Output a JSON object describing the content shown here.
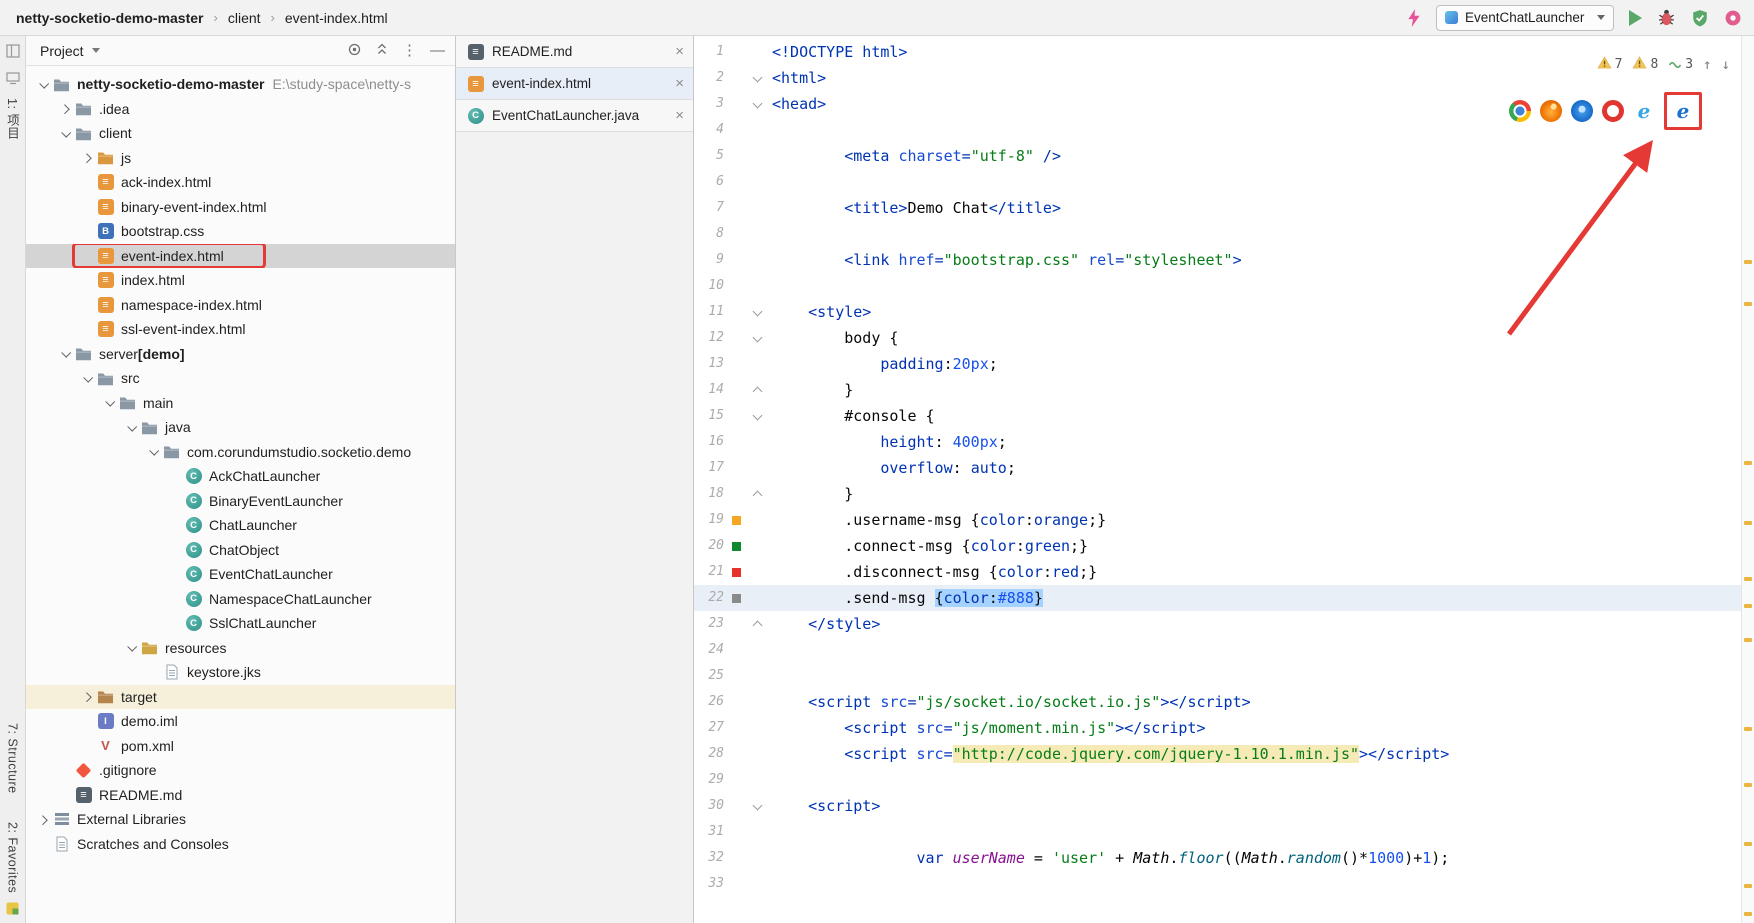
{
  "window": {
    "breadcrumbs": [
      "netty-socketio-demo-master",
      "client",
      "event-index.html"
    ]
  },
  "run": {
    "config": "EventChatLauncher"
  },
  "toolstrip": {
    "top_tab": "1: 项目",
    "structure_tab": "7: Structure",
    "favorites_tab": "2: Favorites"
  },
  "project": {
    "title": "Project",
    "tree": [
      {
        "level": 0,
        "chevron": "open",
        "icon": "folder-project",
        "label": "netty-socketio-demo-master",
        "bold": true,
        "path": "E:\\study-space\\netty-s"
      },
      {
        "level": 1,
        "chevron": "closed",
        "icon": "folder-idea",
        "label": ".idea"
      },
      {
        "level": 1,
        "chevron": "open",
        "icon": "folder",
        "label": "client"
      },
      {
        "level": 2,
        "chevron": "closed",
        "icon": "folder-js",
        "label": "js"
      },
      {
        "level": 2,
        "icon": "html",
        "label": "ack-index.html"
      },
      {
        "level": 2,
        "icon": "html",
        "label": "binary-event-index.html"
      },
      {
        "level": 2,
        "icon": "css",
        "label": "bootstrap.css"
      },
      {
        "level": 2,
        "icon": "html",
        "label": "event-index.html",
        "selected": true,
        "redbox": true
      },
      {
        "level": 2,
        "icon": "html",
        "label": "index.html"
      },
      {
        "level": 2,
        "icon": "html",
        "label": "namespace-index.html"
      },
      {
        "level": 2,
        "icon": "html",
        "label": "ssl-event-index.html"
      },
      {
        "level": 1,
        "chevron": "open",
        "icon": "folder",
        "label": "server",
        "suffix": " [demo]"
      },
      {
        "level": 2,
        "chevron": "open",
        "icon": "folder",
        "label": "src"
      },
      {
        "level": 3,
        "chevron": "open",
        "icon": "folder",
        "label": "main"
      },
      {
        "level": 4,
        "chevron": "open",
        "icon": "folder-java",
        "label": "java"
      },
      {
        "level": 5,
        "chevron": "open",
        "icon": "folder",
        "label": "com.corundumstudio.socketio.demo"
      },
      {
        "level": 6,
        "icon": "class",
        "label": "AckChatLauncher"
      },
      {
        "level": 6,
        "icon": "class",
        "label": "BinaryEventLauncher"
      },
      {
        "level": 6,
        "icon": "class",
        "label": "ChatLauncher"
      },
      {
        "level": 6,
        "icon": "class",
        "label": "ChatObject"
      },
      {
        "level": 6,
        "icon": "class",
        "label": "EventChatLauncher"
      },
      {
        "level": 6,
        "icon": "class",
        "label": "NamespaceChatLauncher"
      },
      {
        "level": 6,
        "icon": "class",
        "label": "SslChatLauncher"
      },
      {
        "level": 4,
        "chevron": "open",
        "icon": "folder-resources",
        "label": "resources"
      },
      {
        "level": 5,
        "icon": "file",
        "label": "keystore.jks"
      },
      {
        "level": 2,
        "chevron": "closed",
        "icon": "folder-target",
        "label": "target",
        "rowbg": "#F6EFDA"
      },
      {
        "level": 2,
        "icon": "iml",
        "label": "demo.iml"
      },
      {
        "level": 2,
        "icon": "maven",
        "label": "pom.xml"
      },
      {
        "level": 1,
        "icon": "git",
        "label": ".gitignore"
      },
      {
        "level": 1,
        "icon": "md",
        "label": "README.md"
      },
      {
        "level": 0,
        "chevron": "closed",
        "icon": "library",
        "label": "External Libraries"
      },
      {
        "level": 0,
        "icon": "scratches",
        "label": "Scratches and Consoles"
      }
    ]
  },
  "editor_tabs": [
    {
      "icon": "md",
      "label": "README.md"
    },
    {
      "icon": "html",
      "label": "event-index.html",
      "active": true
    },
    {
      "icon": "class",
      "label": "EventChatLauncher.java"
    }
  ],
  "editor": {
    "inspections": {
      "warnings": "7",
      "weak_warnings": "8",
      "typos": "3"
    },
    "browsers": [
      {
        "name": "chrome"
      },
      {
        "name": "firefox"
      },
      {
        "name": "safari"
      },
      {
        "name": "opera"
      },
      {
        "name": "ie"
      },
      {
        "name": "edge",
        "boxed": true
      }
    ],
    "stripe_marks": [
      224,
      266,
      425,
      485,
      541,
      568,
      602,
      691,
      747,
      806,
      848,
      876
    ],
    "lines": [
      {
        "s": [
          [
            "<!DOCTYPE html>",
            "tg"
          ]
        ]
      },
      {
        "f": "d",
        "s": [
          [
            "<html>",
            "tg"
          ]
        ]
      },
      {
        "f": "d",
        "s": [
          [
            "<head>",
            "tg"
          ]
        ]
      },
      {
        "s": []
      },
      {
        "s": [
          [
            "        ",
            ""
          ],
          [
            "<meta ",
            "tg"
          ],
          [
            "charset",
            "at"
          ],
          [
            "=",
            "tg"
          ],
          [
            "\"utf-8\"",
            "st"
          ],
          [
            " />",
            "tg"
          ]
        ]
      },
      {
        "s": []
      },
      {
        "s": [
          [
            "        ",
            ""
          ],
          [
            "<title>",
            "tg"
          ],
          [
            "Demo Chat",
            "tx"
          ],
          [
            "</title>",
            "tg"
          ]
        ]
      },
      {
        "s": []
      },
      {
        "s": [
          [
            "        ",
            ""
          ],
          [
            "<link ",
            "tg"
          ],
          [
            "href",
            "at"
          ],
          [
            "=",
            "tg"
          ],
          [
            "\"bootstrap.css\"",
            "st"
          ],
          [
            " ",
            "tx"
          ],
          [
            "rel",
            "at"
          ],
          [
            "=",
            "tg"
          ],
          [
            "\"stylesheet\"",
            "st"
          ],
          [
            ">",
            "tg"
          ]
        ]
      },
      {
        "s": []
      },
      {
        "f": "d",
        "s": [
          [
            "    ",
            ""
          ],
          [
            "<style>",
            "tg"
          ]
        ]
      },
      {
        "f": "d",
        "s": [
          [
            "        ",
            ""
          ],
          [
            "body",
            "se"
          ],
          [
            " {",
            "tx"
          ]
        ]
      },
      {
        "s": [
          [
            "            ",
            ""
          ],
          [
            "padding",
            "pr"
          ],
          [
            ":",
            "tx"
          ],
          [
            "20px",
            "nm"
          ],
          [
            ";",
            "tx"
          ]
        ]
      },
      {
        "f": "u",
        "s": [
          [
            "        ",
            ""
          ],
          [
            "}",
            "tx"
          ]
        ]
      },
      {
        "f": "d",
        "s": [
          [
            "        ",
            ""
          ],
          [
            "#console",
            "se"
          ],
          [
            " {",
            "tx"
          ]
        ]
      },
      {
        "s": [
          [
            "            ",
            ""
          ],
          [
            "height",
            "pr"
          ],
          [
            ": ",
            "tx"
          ],
          [
            "400px",
            "nm"
          ],
          [
            ";",
            "tx"
          ]
        ]
      },
      {
        "s": [
          [
            "            ",
            ""
          ],
          [
            "overflow",
            "pr"
          ],
          [
            ": ",
            "tx"
          ],
          [
            "auto",
            "vl"
          ],
          [
            ";",
            "tx"
          ]
        ]
      },
      {
        "f": "u",
        "s": [
          [
            "        ",
            ""
          ],
          [
            "}",
            "tx"
          ]
        ]
      },
      {
        "chip": "#F5A623",
        "s": [
          [
            "        ",
            ""
          ],
          [
            ".username-msg",
            "se"
          ],
          [
            " {",
            "tx"
          ],
          [
            "color",
            "pr"
          ],
          [
            ":",
            "tx"
          ],
          [
            "orange",
            "vl"
          ],
          [
            ";}",
            "tx"
          ]
        ]
      },
      {
        "chip": "#108A30",
        "s": [
          [
            "        ",
            ""
          ],
          [
            ".connect-msg",
            "se"
          ],
          [
            " {",
            "tx"
          ],
          [
            "color",
            "pr"
          ],
          [
            ":",
            "tx"
          ],
          [
            "green",
            "vl"
          ],
          [
            ";}",
            "tx"
          ]
        ]
      },
      {
        "chip": "#E8312B",
        "s": [
          [
            "        ",
            ""
          ],
          [
            ".disconnect-msg",
            "se"
          ],
          [
            " {",
            "tx"
          ],
          [
            "color",
            "pr"
          ],
          [
            ":",
            "tx"
          ],
          [
            "red",
            "vl"
          ],
          [
            ";}",
            "tx"
          ]
        ]
      },
      {
        "chip": "#8A8A8A",
        "caret": true,
        "s": [
          [
            "        ",
            ""
          ],
          [
            ".send-msg ",
            "se"
          ],
          [
            "{",
            "tx sel"
          ],
          [
            "color",
            "pr sel"
          ],
          [
            ":",
            "tx sel"
          ],
          [
            "#888",
            "nm sel"
          ],
          [
            "}",
            "tx sel"
          ]
        ]
      },
      {
        "f": "u",
        "s": [
          [
            "    ",
            ""
          ],
          [
            "</style>",
            "tg"
          ]
        ]
      },
      {
        "s": []
      },
      {
        "s": []
      },
      {
        "s": [
          [
            "    ",
            ""
          ],
          [
            "<script ",
            "tg"
          ],
          [
            "src",
            "at"
          ],
          [
            "=",
            "tg"
          ],
          [
            "\"js/socket.io/socket.io.js\"",
            "st"
          ],
          [
            "></",
            "tg"
          ],
          [
            "script>",
            "tg"
          ]
        ]
      },
      {
        "s": [
          [
            "        ",
            ""
          ],
          [
            "<script ",
            "tg"
          ],
          [
            "src",
            "at"
          ],
          [
            "=",
            "tg"
          ],
          [
            "\"js/moment.min.js\"",
            "st"
          ],
          [
            "></",
            "tg"
          ],
          [
            "script>",
            "tg"
          ]
        ]
      },
      {
        "s": [
          [
            "        ",
            ""
          ],
          [
            "<script ",
            "tg"
          ],
          [
            "src",
            "at"
          ],
          [
            "=",
            "tg"
          ],
          [
            "\"http://code.jquery.com/jquery-1.10.1.min.js\"",
            "st inj"
          ],
          [
            "></",
            "tg"
          ],
          [
            "script>",
            "tg"
          ]
        ]
      },
      {
        "s": []
      },
      {
        "f": "d",
        "s": [
          [
            "    ",
            ""
          ],
          [
            "<script>",
            "tg"
          ]
        ]
      },
      {
        "s": []
      },
      {
        "s": [
          [
            "                ",
            ""
          ],
          [
            "var ",
            "kw"
          ],
          [
            "userName",
            "id"
          ],
          [
            " = ",
            "tx"
          ],
          [
            "'user'",
            "st"
          ],
          [
            " + ",
            "tx"
          ],
          [
            "Math",
            "mc"
          ],
          [
            ".",
            "tx"
          ],
          [
            "floor",
            "fn"
          ],
          [
            "((",
            "tx"
          ],
          [
            "Math",
            "mc"
          ],
          [
            ".",
            "tx"
          ],
          [
            "random",
            "fn"
          ],
          [
            "()*",
            "tx"
          ],
          [
            "1000",
            "nm"
          ],
          [
            ")+",
            "tx"
          ],
          [
            "1",
            "nm"
          ],
          [
            ");",
            "tx"
          ]
        ]
      },
      {
        "s": []
      }
    ]
  },
  "colors": {
    "annotation_red": "#E53935",
    "selection": "#A6D2FF",
    "caret_row": "#E9EFF7",
    "injection_bg": "#F6EBB6",
    "tree_selection": "#D4D4D4"
  }
}
